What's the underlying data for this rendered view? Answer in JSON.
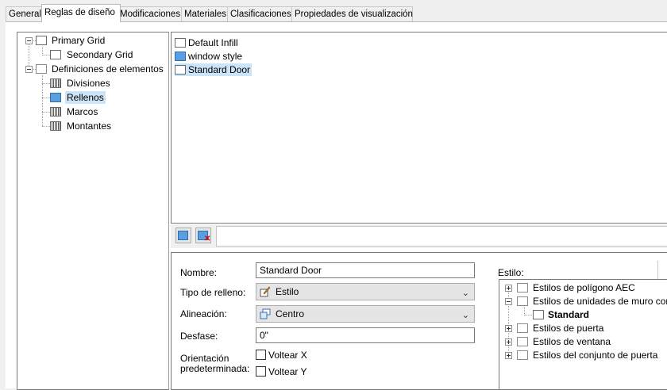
{
  "tabs": [
    "General",
    "Reglas de diseño",
    "Modificaciones",
    "Materiales",
    "Clasificaciones",
    "Propiedades de visualización"
  ],
  "active_tab": "Reglas de diseño",
  "tree": {
    "primary_grid": "Primary Grid",
    "secondary_grid": "Secondary Grid",
    "element_definitions": "Definiciones de elementos",
    "divisions": "Divisiones",
    "infills": "Rellenos",
    "frames": "Marcos",
    "mullions": "Montantes"
  },
  "infill_list": [
    "Default Infill",
    "window style",
    "Standard Door"
  ],
  "toolbar": {
    "new_icon": "new-infill-icon",
    "delete_icon": "delete-infill-icon"
  },
  "properties": {
    "name_label": "Nombre:",
    "name_value": "Standard Door",
    "infill_type_label": "Tipo de relleno:",
    "infill_type_value": "Estilo",
    "alignment_label": "Alineación:",
    "alignment_value": "Centro",
    "offset_label": "Desfase:",
    "offset_value": "0\"",
    "orientation_label_1": "Orientación",
    "orientation_label_2": "predeterminada:",
    "flip_x_label": "Voltear X",
    "flip_y_label": "Voltear Y",
    "flip_x_checked": false,
    "flip_y_checked": false
  },
  "style_panel": {
    "label": "Estilo:",
    "items": [
      "Estilos de polígono AEC",
      "Estilos de unidades de muro cortina",
      "Standard",
      "Estilos de puerta",
      "Estilos de ventana",
      "Estilos del conjunto de puerta"
    ]
  },
  "colors": {
    "selection": "#cce4f7",
    "infill_icon": "#5aa0e0",
    "border": "#7a7a7a"
  }
}
